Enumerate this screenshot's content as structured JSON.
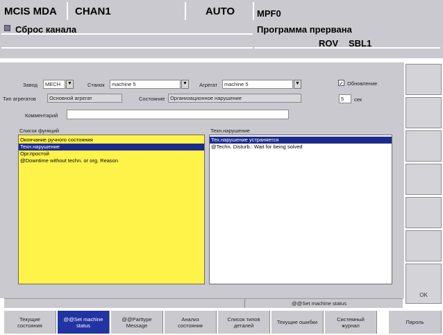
{
  "header": {
    "mode": "MCIS MDA",
    "channel": "CHAN1",
    "auto": "AUTO",
    "program_name": "MPF0",
    "channel_reset": "Сброс канала",
    "program_status": "Программа прервана",
    "rov": "ROV",
    "sbl": "SBL1"
  },
  "form": {
    "plant_label": "Завод",
    "plant_value": "MECH",
    "machine_label": "Станок",
    "machine_value": "machine 5",
    "unit_label": "Агрегат",
    "unit_value": "machine 5",
    "update_label": "Обновление",
    "unit_type_label": "Тип агрегатов",
    "unit_type_value": "Основной агрегат",
    "state_label": "Состояние",
    "state_value": "Организационное нарушение",
    "interval_value": "5",
    "interval_unit": "сек",
    "comment_label": "Комментарий",
    "comment_value": ""
  },
  "functions_list": {
    "title": "Список функций",
    "items": [
      "Окончание ручного состояния",
      "Техн.нарушение",
      "Орг.простой",
      "@Downtime without techn. or org.  Reason"
    ],
    "selected_index": 1
  },
  "tech_list": {
    "title": "Техн.нарушение",
    "items": [
      "Тех.нарушение устраняется",
      "@Techn. Disturb.: Wait for being solved"
    ],
    "selected_index": 0
  },
  "status_bar": {
    "text": "@@Set machine status"
  },
  "vertical_softkeys": {
    "ok_label": "OK"
  },
  "softkeys": [
    {
      "line1": "Текущие",
      "line2": "состояния"
    },
    {
      "line1": "@@Set machine",
      "line2": "status"
    },
    {
      "line1": "@@Parttype",
      "line2": "Message"
    },
    {
      "line1": "Анализ",
      "line2": "состояния"
    },
    {
      "line1": "Список типов",
      "line2": "деталей"
    },
    {
      "line1": "Текущие ошибки",
      "line2": ""
    },
    {
      "line1": "Системный",
      "line2": "журнал"
    },
    {
      "line1": "Пароль",
      "line2": ""
    }
  ],
  "colors": {
    "selection": "#1c2a8c",
    "list_background": "#fff34a",
    "frame": "#c9c9cf"
  }
}
